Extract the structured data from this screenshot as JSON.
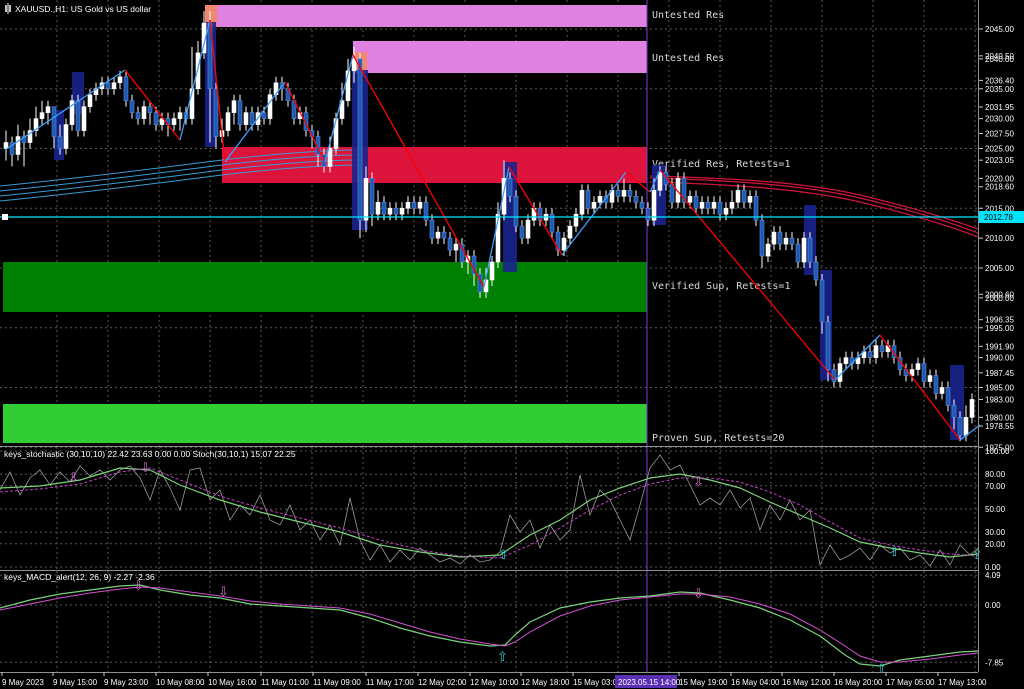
{
  "window": {
    "title": "XAUUSD.,H1: US Gold vs US dollar"
  },
  "colors": {
    "background": "#000000",
    "grid": "#5a5a5a",
    "bull_body": "#ffffff",
    "bear_body": "#1e5ab4",
    "res_zone_untested": "#e080e0",
    "res_zone_verified": "#dc143c",
    "sup_zone_verified": "#008000",
    "sup_zone_proven": "#32cd32",
    "price_line": "#00e5ff",
    "zigzag_up": "#3aa0ff",
    "zigzag_down": "#ff0000",
    "ma_cyan": "#3c9bd2",
    "ma_red": "#d2143c",
    "period_separator": "#7a3bd1"
  },
  "main_panel": {
    "price_scale": [
      "2045.00",
      "2040.50",
      "2040.00",
      "2036.40",
      "2035.00",
      "2031.95",
      "2030.00",
      "2027.50",
      "2025.00",
      "2023.05",
      "2020.00",
      "2018.60",
      "2015.00",
      "2010.00",
      "2005.00",
      "2000.60",
      "2000.00",
      "1996.35",
      "1995.00",
      "1991.90",
      "1990.00",
      "1987.45",
      "1985.00",
      "1983.00",
      "1980.00",
      "1978.55",
      "1975.00"
    ],
    "current_price": "2012.78",
    "zones": [
      {
        "label": "Untested Res",
        "type": "untested_res"
      },
      {
        "label": "Untested Res",
        "type": "untested_res"
      },
      {
        "label": "Verified Res, Retests=1",
        "type": "verified_res"
      },
      {
        "label": "Verified Sup, Retests=1",
        "type": "verified_sup"
      },
      {
        "label": "Proven Sup, Retests=20",
        "type": "proven_sup"
      }
    ]
  },
  "stoch_panel": {
    "title": "keys_stochastic (30,10,10) 22.42 23.63 0.00 0.00 Stoch(30,10,1) 15.07 22.25",
    "scale": [
      "100.00",
      "80.00",
      "70.00",
      "50.00",
      "30.00",
      "20.00",
      "0.00"
    ]
  },
  "macd_panel": {
    "title": "keys_MACD_alert(12, 26, 9) -2.27 -2.36",
    "scale": [
      "4.09",
      "0.00",
      "-7.85"
    ]
  },
  "time_axis": {
    "labels": [
      "9 May 2023",
      "9 May 15:00",
      "9 May 23:00",
      "10 May 08:00",
      "10 May 16:00",
      "11 May 01:00",
      "11 May 09:00",
      "11 May 17:00",
      "12 May 02:00",
      "12 May 10:00",
      "12 May 18:00",
      "15 May 03:00",
      "15 May 19:00",
      "16 May 04:00",
      "16 May 12:00",
      "16 May 20:00",
      "17 May 05:00",
      "17 May 13:00"
    ],
    "highlight": "2023.05.15 14:00"
  }
}
